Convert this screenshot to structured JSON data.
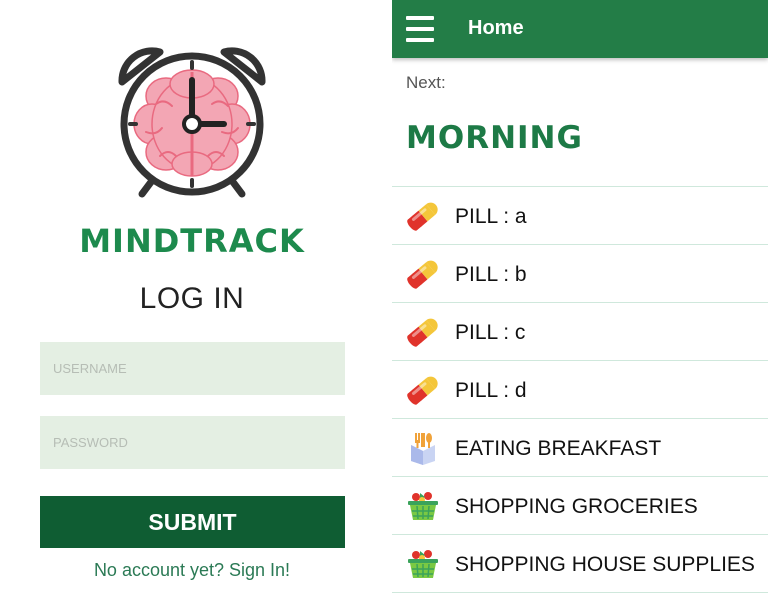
{
  "login": {
    "app_name": "MINDTRACK",
    "heading": "LOG IN",
    "username_placeholder": "USERNAME",
    "username_value": "",
    "password_placeholder": "PASSWORD",
    "password_value": "",
    "submit_label": "SUBMIT",
    "signup_prompt": "No account yet? Sign In!",
    "logo_icon": "brain-alarm-clock-icon"
  },
  "home": {
    "title": "Home",
    "menu_icon": "hamburger-menu-icon",
    "next_label": "Next:",
    "period": "MORNING",
    "tasks": [
      {
        "icon": "pill-icon",
        "label": "PILL : a"
      },
      {
        "icon": "pill-icon",
        "label": "PILL : b"
      },
      {
        "icon": "pill-icon",
        "label": "PILL : c"
      },
      {
        "icon": "pill-icon",
        "label": "PILL : d"
      },
      {
        "icon": "breakfast-icon",
        "label": "EATING BREAKFAST"
      },
      {
        "icon": "grocery-basket-icon",
        "label": "SHOPPING GROCERIES"
      },
      {
        "icon": "grocery-basket-icon",
        "label": "SHOPPING HOUSE SUPPLIES"
      }
    ]
  },
  "colors": {
    "brand_green": "#1d8a4d",
    "app_bar": "#237d47",
    "submit_button": "#0f5d33",
    "input_bg": "#e4efe3",
    "divider": "#cfe8dc",
    "pill_red": "#e0332b",
    "pill_yellow": "#f4c63a"
  }
}
